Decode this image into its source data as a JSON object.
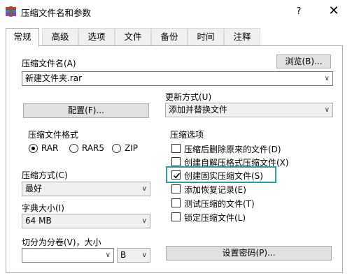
{
  "window": {
    "title": "压缩文件名和参数",
    "help": "?",
    "close": "✕"
  },
  "tabs": [
    "常规",
    "高级",
    "选项",
    "文件",
    "备份",
    "时间",
    "注释"
  ],
  "general": {
    "archive_name_label": "压缩文件名(A)",
    "browse_label": "浏览(B)...",
    "archive_name_value": "新建文件夹.rar",
    "update_mode_label": "更新方式(U)",
    "update_mode_value": "添加并替换文件",
    "profile_label": "配置(F)...",
    "format_group_label": "压缩文件格式",
    "formats": [
      "RAR",
      "RAR5",
      "ZIP"
    ],
    "selected_format": "RAR",
    "method_label": "压缩方式(C)",
    "method_value": "最好",
    "dict_label": "字典大小(I)",
    "dict_value": "64 MB",
    "split_label": "切分为分卷(V)，大小",
    "split_value": "",
    "split_unit": "B",
    "password_label": "设置密码(P)...",
    "options_group_label": "压缩选项",
    "options": [
      {
        "label": "压缩后删除原来的文件(D)",
        "checked": false
      },
      {
        "label": "创建自解压格式压缩文件(X)",
        "checked": false
      },
      {
        "label": "创建固实压缩文件(S)",
        "checked": true
      },
      {
        "label": "添加恢复记录(E)",
        "checked": false
      },
      {
        "label": "测试压缩的文件(T)",
        "checked": false
      },
      {
        "label": "锁定压缩文件(L)",
        "checked": false
      }
    ],
    "highlight_color": "#26a3a6"
  }
}
